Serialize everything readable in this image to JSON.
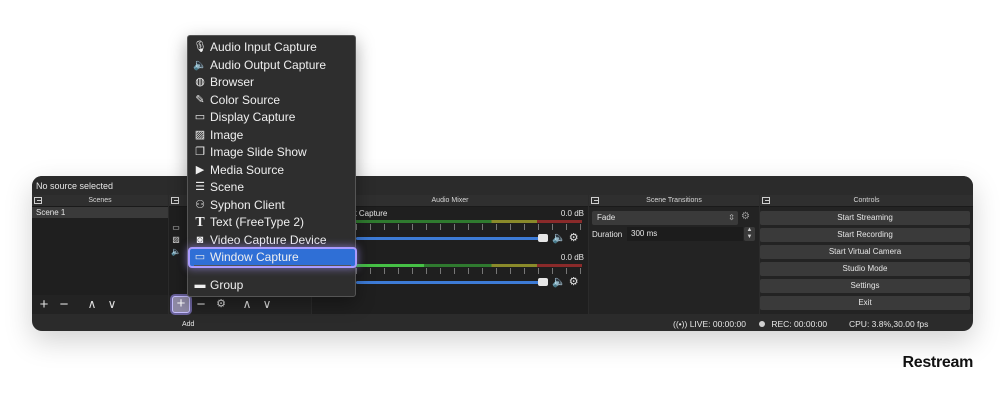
{
  "status_top": "No source selected",
  "scenes": {
    "title": "Scenes",
    "items": [
      "Scene 1"
    ],
    "toolbar": [
      "+",
      "−",
      "∧",
      "∨"
    ]
  },
  "sources": {
    "add_tooltip": "Add",
    "toolbar": [
      "+",
      "−",
      "⚙",
      "∧",
      "∨"
    ]
  },
  "audio_mixer": {
    "title": "Audio Mixer",
    "channels": [
      {
        "name": "ut Capture",
        "db": "0.0 dB"
      },
      {
        "name": "",
        "db": "0.0 dB"
      }
    ]
  },
  "scene_transitions": {
    "title": "Scene Transitions",
    "transition": "Fade",
    "duration_label": "Duration",
    "duration_value": "300 ms"
  },
  "controls": {
    "title": "Controls",
    "buttons": [
      "Start Streaming",
      "Start Recording",
      "Start Virtual Camera",
      "Studio Mode",
      "Settings",
      "Exit"
    ]
  },
  "status_bar": {
    "live": "LIVE: 00:00:00",
    "rec": "REC: 00:00:00",
    "cpu": "CPU: 3.8%,30.00 fps"
  },
  "add_menu": {
    "items": [
      {
        "label": "Audio Input Capture",
        "icon": "microphone-icon"
      },
      {
        "label": "Audio Output Capture",
        "icon": "speaker-icon"
      },
      {
        "label": "Browser",
        "icon": "globe-icon"
      },
      {
        "label": "Color Source",
        "icon": "brush-icon"
      },
      {
        "label": "Display Capture",
        "icon": "monitor-icon"
      },
      {
        "label": "Image",
        "icon": "image-icon"
      },
      {
        "label": "Image Slide Show",
        "icon": "slideshow-icon"
      },
      {
        "label": "Media Source",
        "icon": "play-icon"
      },
      {
        "label": "Scene",
        "icon": "list-icon"
      },
      {
        "label": "Syphon Client",
        "icon": "gamepad-icon"
      },
      {
        "label": "Text (FreeType 2)",
        "icon": "text-icon"
      },
      {
        "label": "Video Capture Device",
        "icon": "camera-icon"
      },
      {
        "label": "Window Capture",
        "icon": "window-icon"
      }
    ],
    "group": {
      "label": "Group",
      "icon": "folder-icon"
    },
    "selected": "Window Capture"
  },
  "brand": "Restream",
  "colors": {
    "highlight": "#2f6fd6",
    "glow": "#a99bff",
    "slider": "#3d7bd6"
  }
}
